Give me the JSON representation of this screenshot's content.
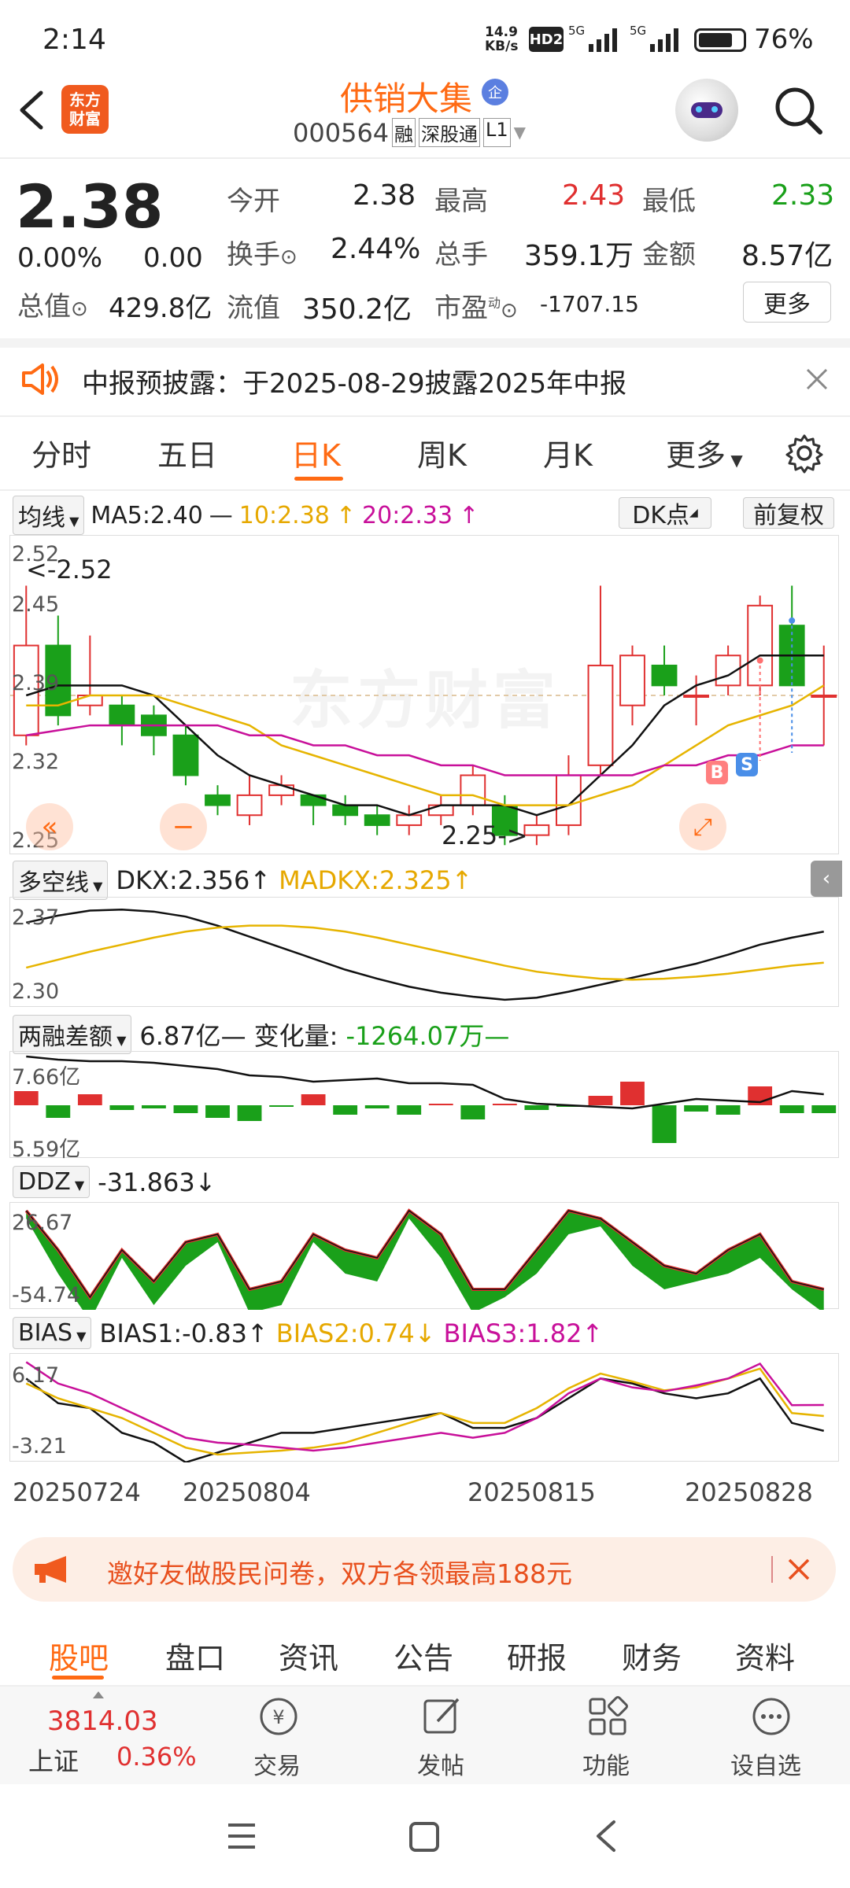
{
  "status_bar": {
    "time": "2:14",
    "net_speed_top": "14.9",
    "net_speed_bottom": "KB/s",
    "hd": "HD2",
    "sig1": "5G",
    "sig2": "5G",
    "battery": "76%"
  },
  "header": {
    "logo_line1": "东方",
    "logo_line2": "财富",
    "stock_name": "供销大集",
    "badge": "企",
    "code": "000564",
    "tag_rong": "融",
    "tag_sgt": "深股通",
    "tag_l1": "L1"
  },
  "quote": {
    "price": "2.38",
    "change_pct": "0.00%",
    "change": "0.00",
    "open_label": "今开",
    "open": "2.38",
    "high_label": "最高",
    "high": "2.43",
    "low_label": "最低",
    "low": "2.33",
    "turnover_label": "换手",
    "turnover": "2.44%",
    "volume_label": "总手",
    "volume": "359.1万",
    "amount_label": "金额",
    "amount": "8.57亿",
    "mktcap_label": "总值",
    "mktcap": "429.8亿",
    "float_label": "流值",
    "float": "350.2亿",
    "pe_label": "市盈",
    "pe_sup": "动",
    "pe": "-1707.15",
    "more_button": "更多"
  },
  "notice": {
    "text": "中报预披露：于2025-08-29披露2025年中报"
  },
  "tabs": [
    {
      "label": "分时"
    },
    {
      "label": "五日"
    },
    {
      "label": "日K",
      "active": true
    },
    {
      "label": "周K"
    },
    {
      "label": "月K"
    },
    {
      "label": "更多"
    }
  ],
  "kline": {
    "ma_selector": "均线",
    "ma5": "MA5:2.40",
    "ma10": "10:2.38",
    "ma20": "20:2.33",
    "dk_button": "DK点",
    "fq_button": "前复权",
    "y_labels": [
      "2.52",
      "2.45",
      "2.39",
      "2.32",
      "2.25"
    ],
    "max_marker": "2.52",
    "min_marker": "2.25",
    "buy_marker": "B",
    "sell_marker": "S",
    "watermark": "东方财富"
  },
  "dkx": {
    "selector": "多空线",
    "dkx": "DKX:2.356",
    "madkx": "MADKX:2.325",
    "y_top": "2.37",
    "y_bottom": "2.30"
  },
  "margin": {
    "selector": "两融差额",
    "value": "6.87亿",
    "change_label": "变化量:",
    "change": "-1264.07万",
    "y_top": "7.66亿",
    "y_bottom": "5.59亿"
  },
  "ddz": {
    "selector": "DDZ",
    "value": "-31.863",
    "y_top": "26.67",
    "y_bottom": "-54.74"
  },
  "bias": {
    "selector": "BIAS",
    "bias1": "BIAS1:-0.83",
    "bias2": "BIAS2:0.74",
    "bias3": "BIAS3:1.82",
    "y_top": "6.17",
    "y_bottom": "-3.21"
  },
  "dates": [
    "20250724",
    "20250804",
    "20250815",
    "20250828"
  ],
  "ad_banner": {
    "text": "邀好友做股民问卷，双方各领最高188元"
  },
  "bottom_tabs": [
    {
      "label": "股吧",
      "active": true
    },
    {
      "label": "盘口"
    },
    {
      "label": "资讯"
    },
    {
      "label": "公告"
    },
    {
      "label": "研报"
    },
    {
      "label": "财务"
    },
    {
      "label": "资料"
    }
  ],
  "footer": {
    "index_value": "3814.03",
    "index_name": "上证",
    "index_change": "0.36%",
    "trade": "交易",
    "post": "发帖",
    "func": "功能",
    "watchlist": "设自选"
  },
  "colors": {
    "up": "#e03030",
    "down": "#1aa01a",
    "accent": "#ff6a13",
    "ma10": "#e6a800",
    "ma20": "#c8109a"
  }
}
